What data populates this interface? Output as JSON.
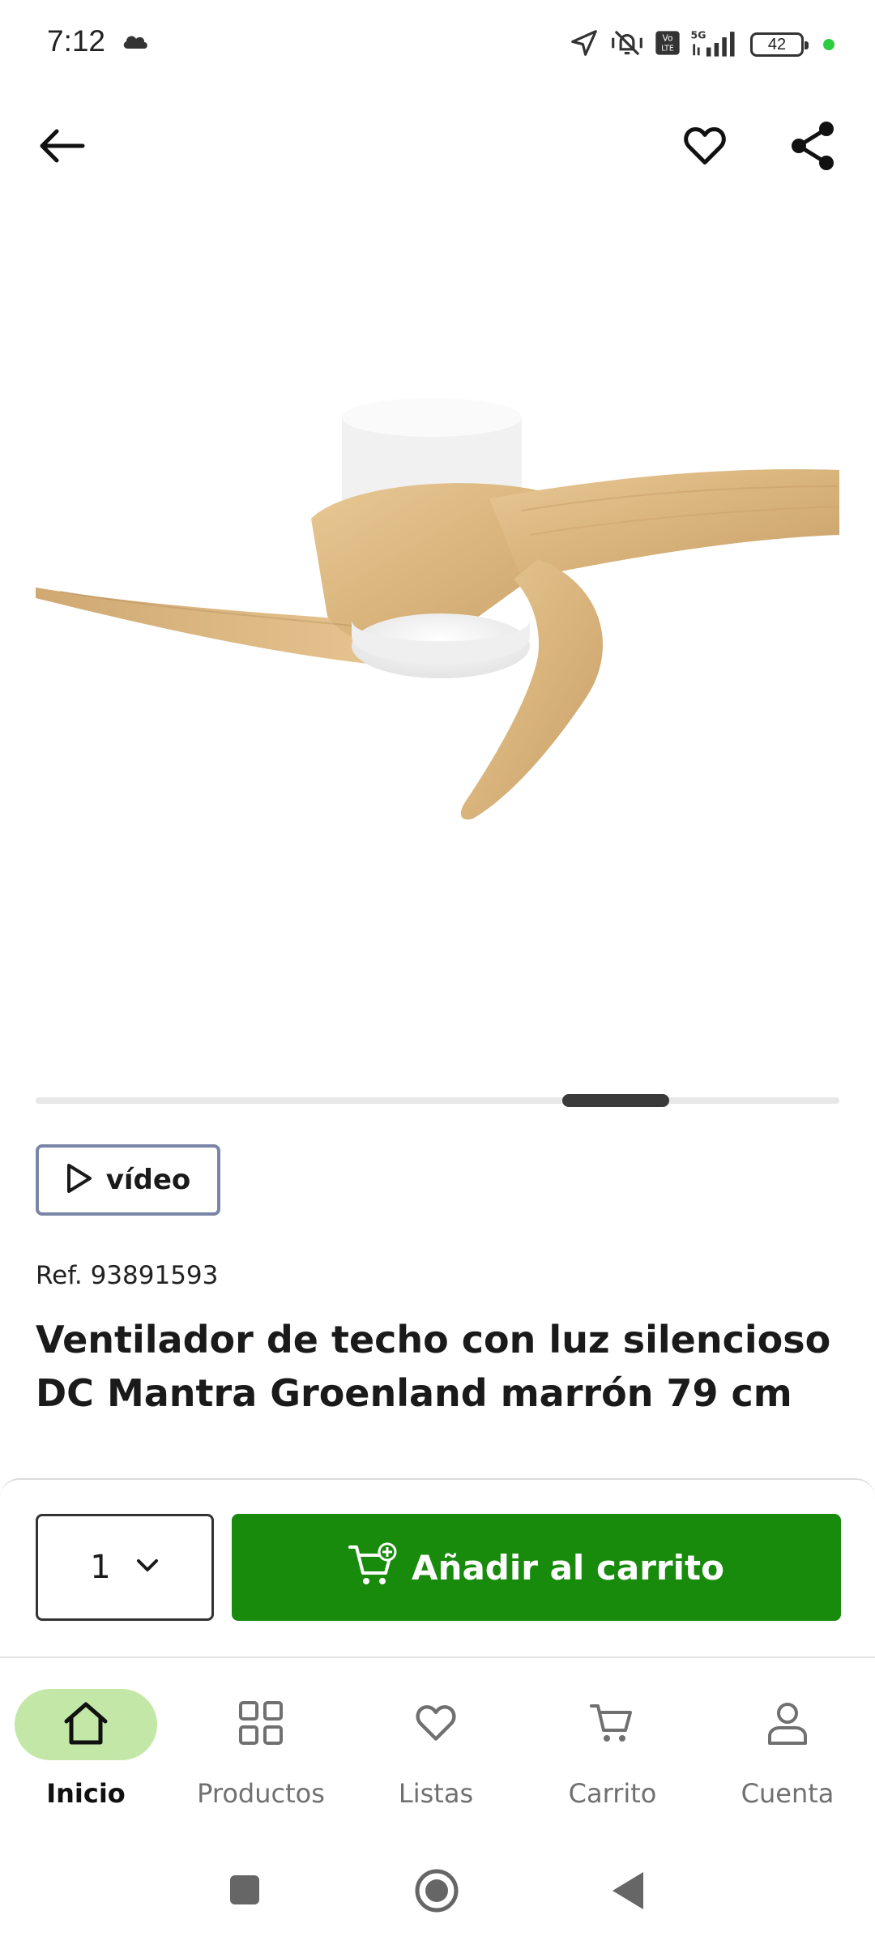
{
  "status_bar": {
    "time": "7:12",
    "battery": "42",
    "network": "5G"
  },
  "product": {
    "image_alt": "",
    "ref": "Ref. 93891593",
    "title": "Ventilador de techo con luz silencioso DC Mantra Groenland marrón 79 cm",
    "video_label": "vídeo",
    "carousel": {
      "total_slides": 9,
      "active_slide": 6
    }
  },
  "cart": {
    "quantity": "1",
    "add_label": "Añadir al carrito",
    "accent": "#188a0c"
  },
  "nav": {
    "items": [
      {
        "label": "Inicio",
        "icon": "home-icon",
        "active": true
      },
      {
        "label": "Productos",
        "icon": "grid-icon",
        "active": false
      },
      {
        "label": "Listas",
        "icon": "heart-icon",
        "active": false
      },
      {
        "label": "Carrito",
        "icon": "cart-icon",
        "active": false
      },
      {
        "label": "Cuenta",
        "icon": "user-icon",
        "active": false
      }
    ],
    "active_bg": "#c3e7a6"
  }
}
